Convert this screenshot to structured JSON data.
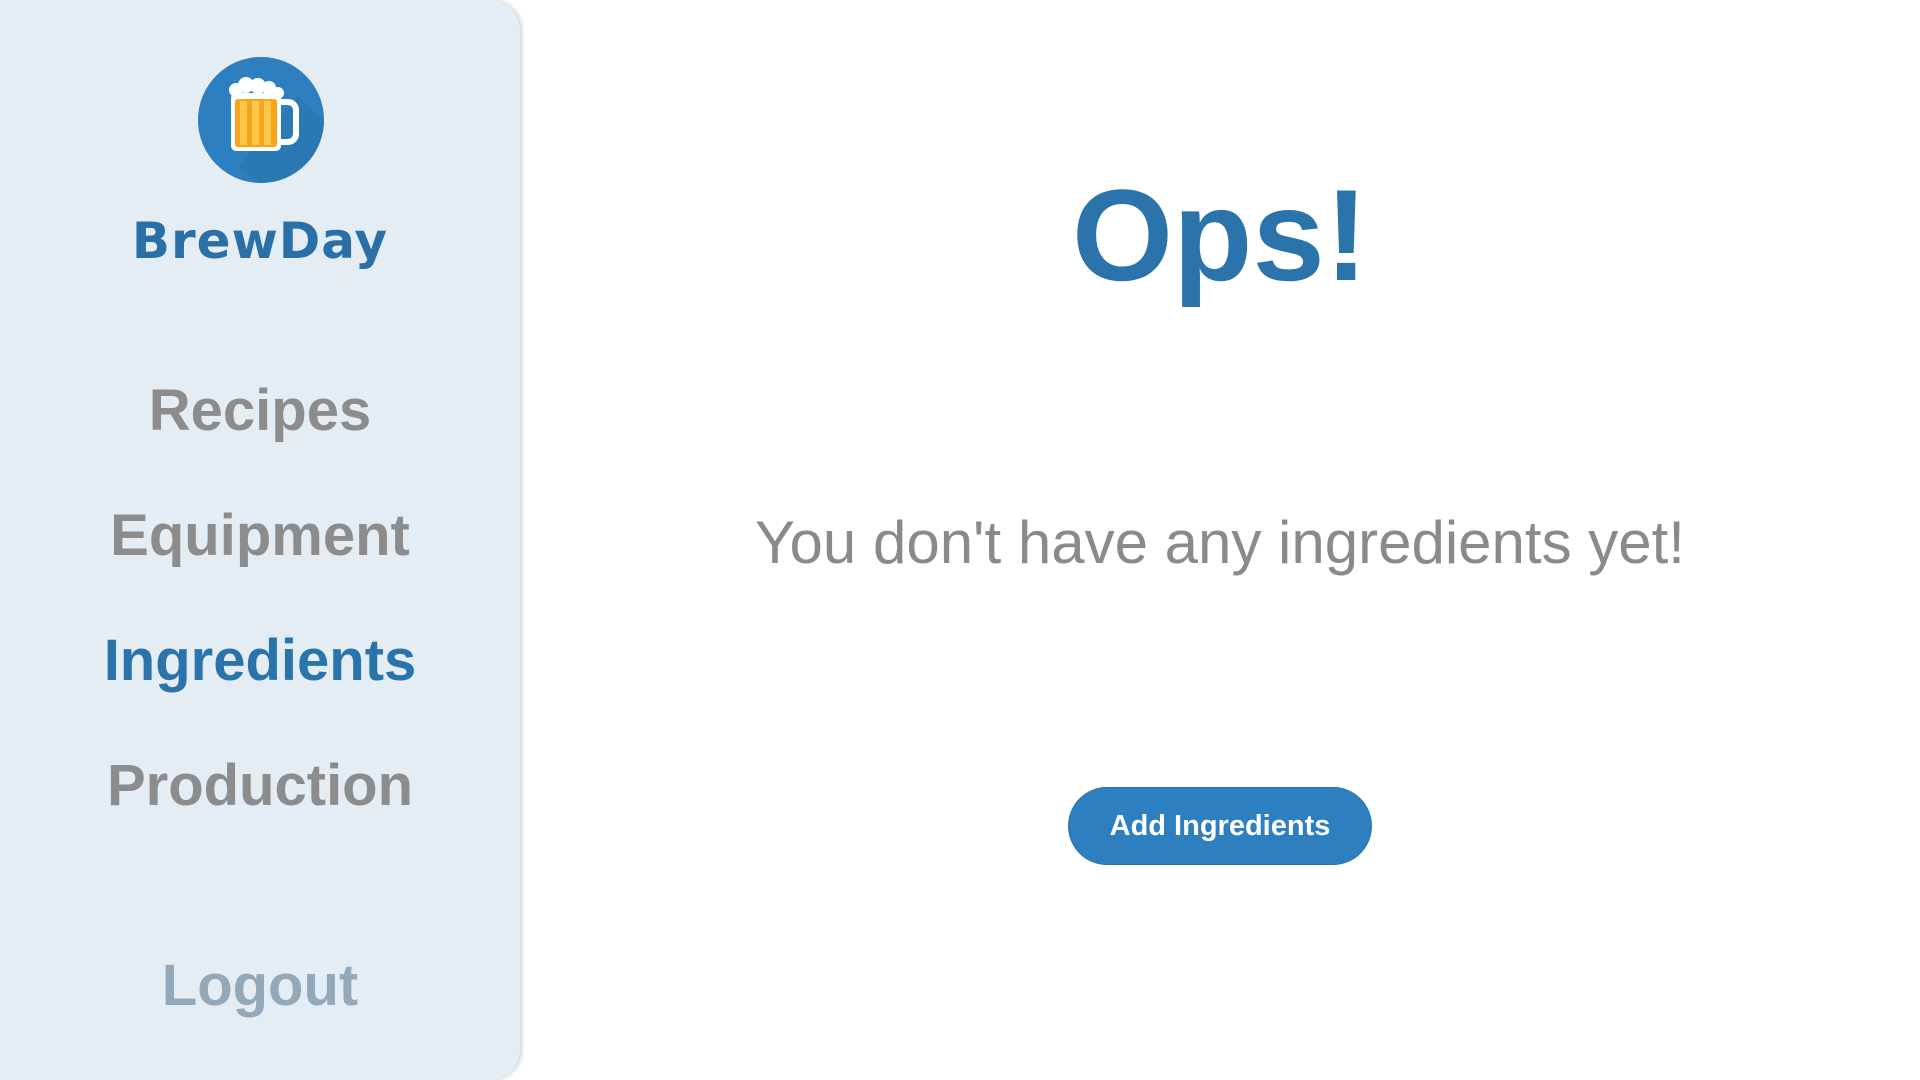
{
  "sidebar": {
    "logo_icon": "beer-mug-icon",
    "brand": "BrewDay",
    "items": [
      {
        "label": "Recipes",
        "active": false
      },
      {
        "label": "Equipment",
        "active": false
      },
      {
        "label": "Ingredients",
        "active": true
      },
      {
        "label": "Production",
        "active": false
      }
    ],
    "logout_label": "Logout"
  },
  "main": {
    "title": "Ops!",
    "message": "You don't have any ingredients yet!",
    "add_button_label": "Add Ingredients"
  },
  "colors": {
    "accent": "#2a74ab",
    "sidebar_bg": "#e4ecf4",
    "nav_text": "#8c8c8c",
    "logout_text": "#93a9ba"
  }
}
